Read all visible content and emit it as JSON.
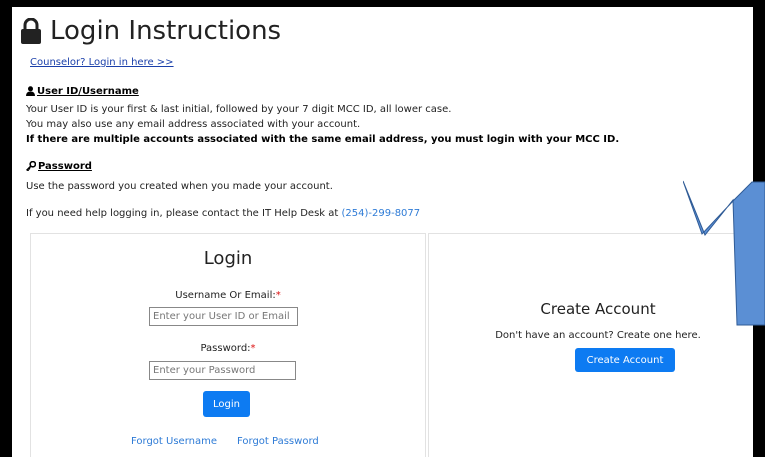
{
  "page": {
    "title": "Login Instructions",
    "counselor_link": "Counselor? Login in here >>"
  },
  "user_id_section": {
    "heading": "User ID/Username",
    "line1": "Your User ID is your first & last initial, followed by your 7 digit MCC ID, all lower case.",
    "line2": "You may also use any email address associated with your account.",
    "warning": "If there are multiple accounts associated with the same email address, you must login with your MCC ID."
  },
  "password_section": {
    "heading": "Password",
    "line1": "Use the password you created when you made your account."
  },
  "help": {
    "text": "If you need help logging in, please contact the IT Help Desk at",
    "phone": "(254)-299-8077"
  },
  "login_form": {
    "heading": "Login",
    "username_label": "Username Or Email:",
    "username_placeholder": "Enter your User ID or Email",
    "password_label": "Password:",
    "password_placeholder": "Enter your Password",
    "required_mark": "*",
    "submit_label": "Login",
    "forgot_username": "Forgot Username",
    "forgot_password": "Forgot Password"
  },
  "create_account": {
    "heading": "Create Account",
    "description": "Don't have an account? Create one here.",
    "button_label": "Create Account"
  },
  "colors": {
    "primary_button": "#0d7bf2",
    "link": "#2e7bd6",
    "required": "#dd1111",
    "annotation_arrow": "#5b8fd4"
  },
  "icons": {
    "title_icon": "lock-icon",
    "user_icon": "user-icon",
    "password_icon": "key-icon",
    "annotation": "down-arrow-annotation"
  }
}
